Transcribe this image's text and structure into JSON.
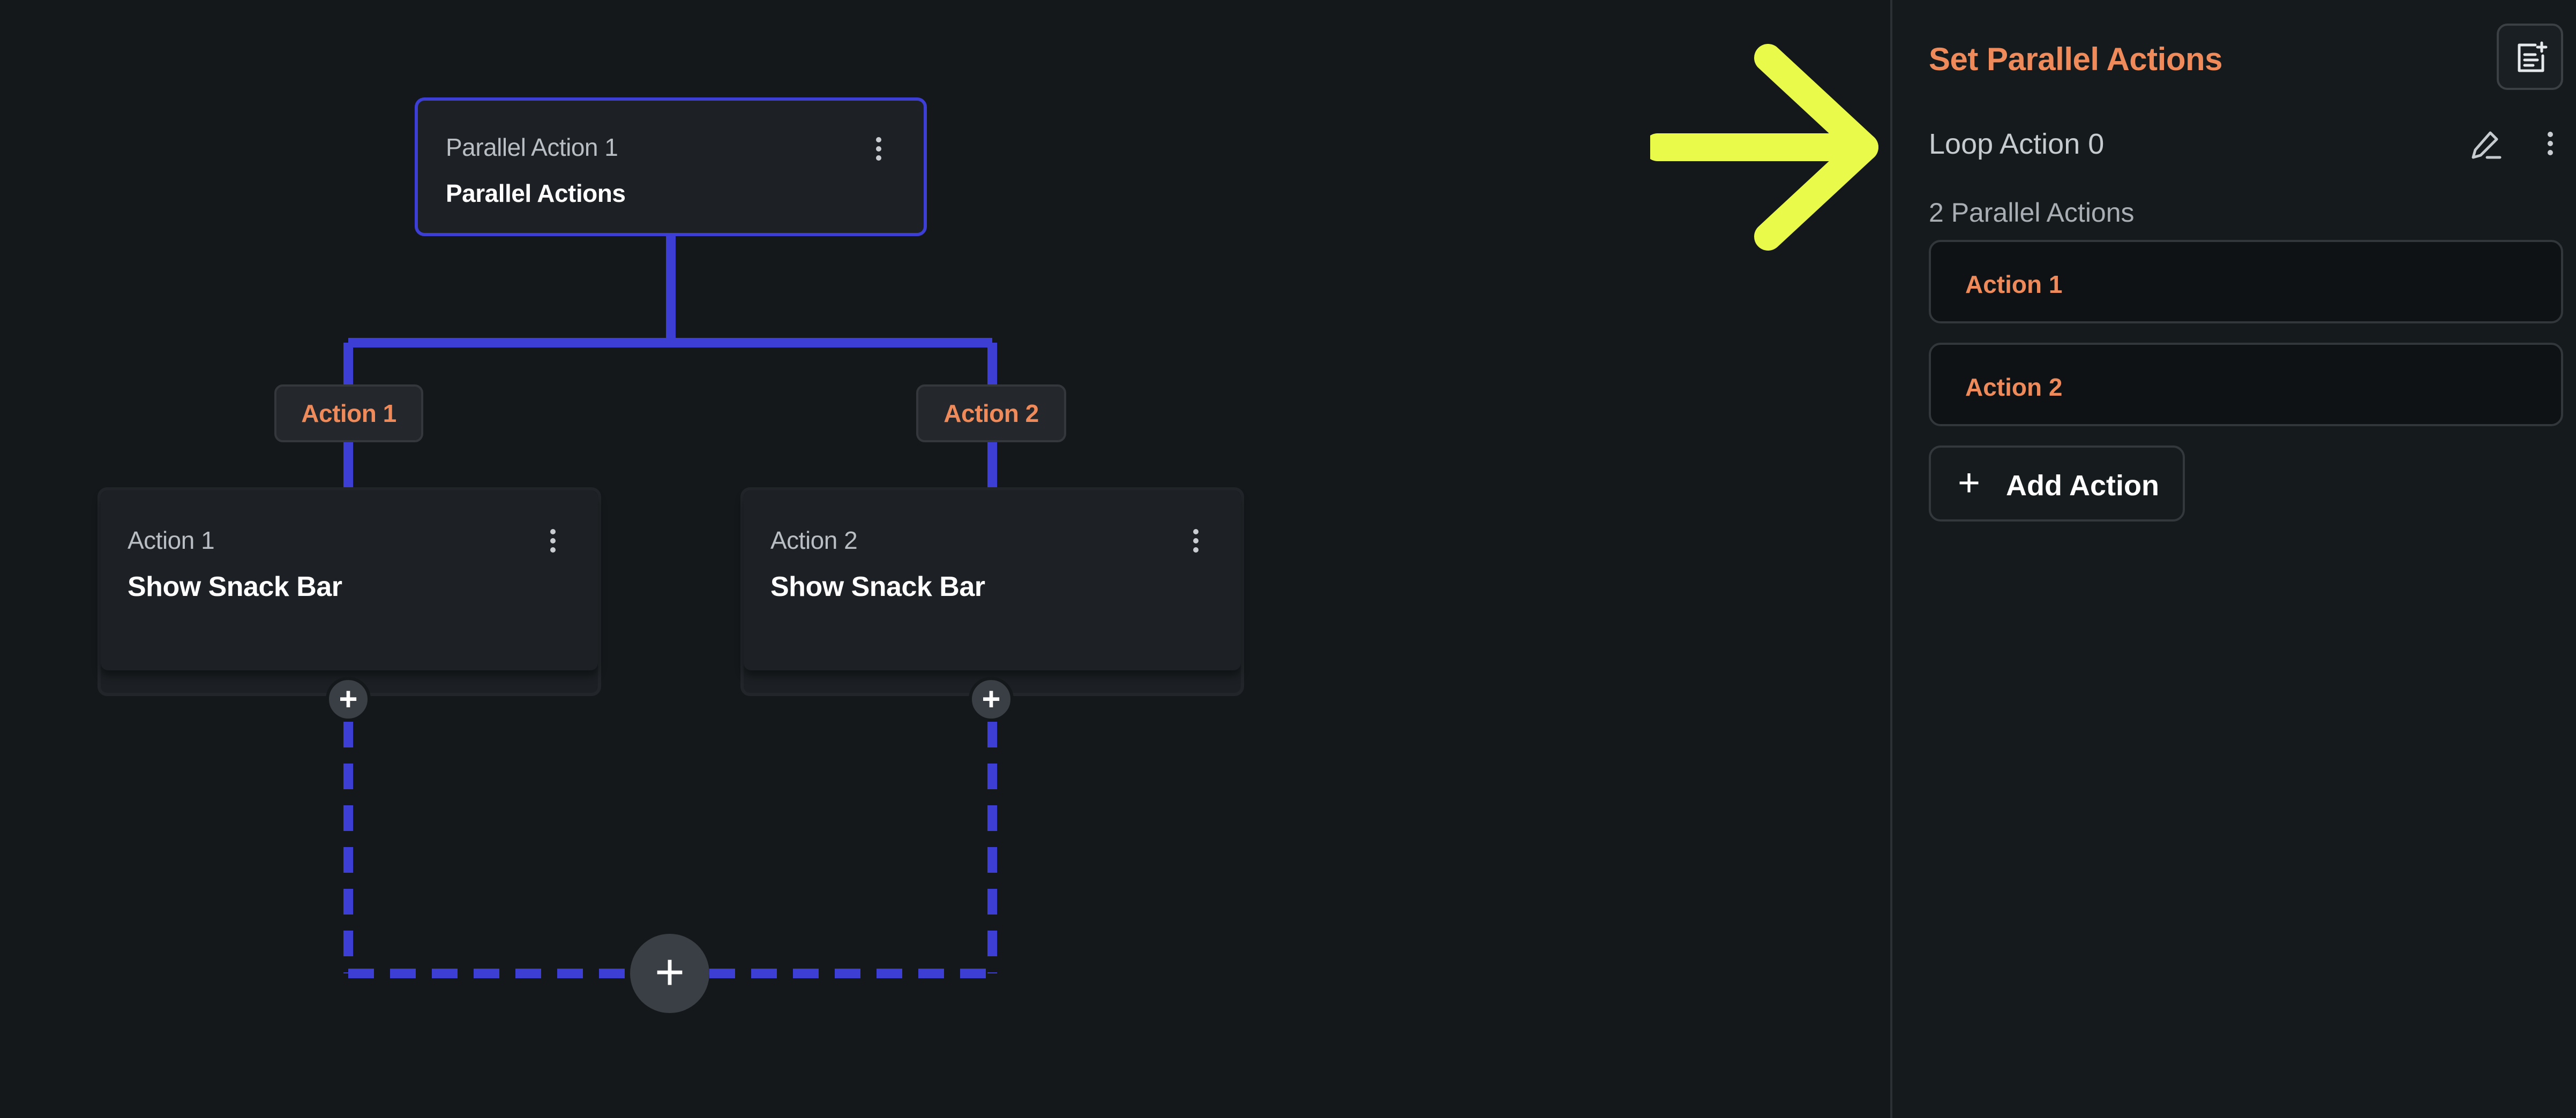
{
  "canvas": {
    "parent_node": {
      "subtitle": "Parallel Action 1",
      "title": "Parallel Actions"
    },
    "branch_labels": [
      "Action 1",
      "Action 2"
    ],
    "child_nodes": [
      {
        "subtitle": "Action 1",
        "title": "Show Snack Bar"
      },
      {
        "subtitle": "Action 2",
        "title": "Show Snack Bar"
      }
    ],
    "plus_glyph": "+"
  },
  "panel": {
    "title": "Set Parallel Actions",
    "loop_label": "Loop Action 0",
    "parallel_count": "2 Parallel Actions",
    "actions": [
      "Action 1",
      "Action 2"
    ],
    "add_action_label": "Add Action",
    "add_action_icon": "+"
  },
  "icons": {
    "more": "kebab-vertical-icon",
    "edit": "pencil-icon",
    "notes": "note-add-icon",
    "annotation": "arrow-right-icon"
  },
  "colors": {
    "accent_orange": "#ef8a5a",
    "connector_blue": "#3c3ed4",
    "annotation_yellow": "#e9fa4a",
    "background": "#14181b"
  }
}
